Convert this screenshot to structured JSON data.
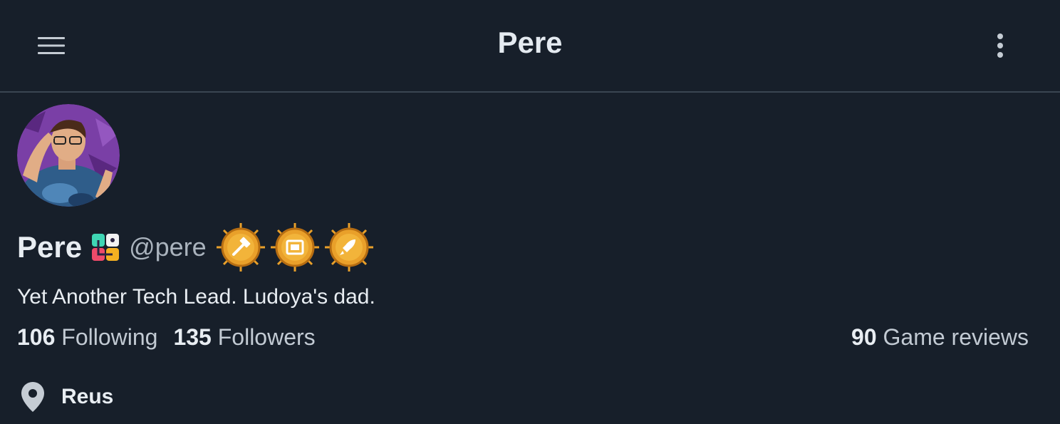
{
  "header": {
    "title": "Pere",
    "menu_icon": "hamburger-menu-icon",
    "more_icon": "vertical-dots-icon"
  },
  "profile": {
    "display_name": "Pere",
    "handle": "@pere",
    "app_icon": "colorful-app-icon",
    "badges": [
      {
        "icon": "hammer-badge-icon"
      },
      {
        "icon": "picture-frame-badge-icon"
      },
      {
        "icon": "rocket-badge-icon"
      }
    ],
    "bio": "Yet Another Tech Lead. Ludoya's dad.",
    "stats": {
      "following_count": "106",
      "following_label": "Following",
      "followers_count": "135",
      "followers_label": "Followers",
      "reviews_count": "90",
      "reviews_label": "Game reviews"
    },
    "location": "Reus"
  },
  "colors": {
    "background": "#171f2a",
    "divider": "#3a4552",
    "text": "#e8edf2",
    "muted": "#aab3bd",
    "badge_gold": "#e9a02a"
  }
}
